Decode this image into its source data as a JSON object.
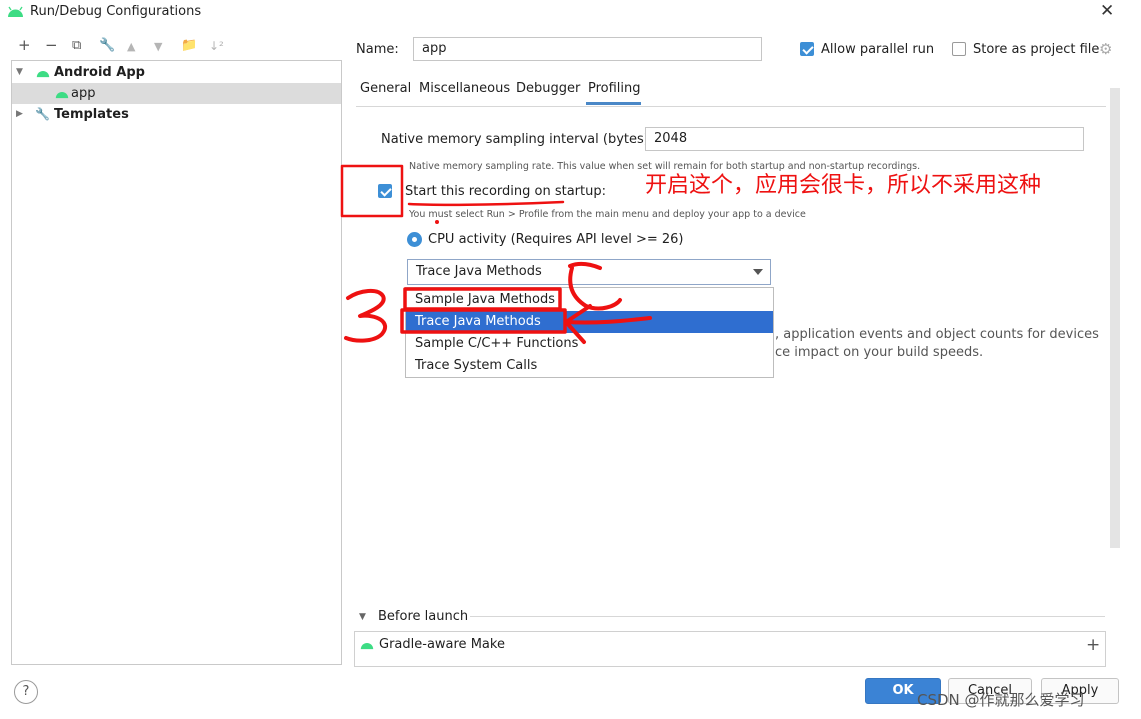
{
  "window": {
    "title": "Run/Debug Configurations",
    "close_glyph": "✕"
  },
  "toolbar": {
    "add": "+",
    "remove": "−",
    "copy": "⧉",
    "edit": "🔧",
    "up": "▲",
    "down": "▼",
    "folder": "📁",
    "sort": "↓²"
  },
  "tree": {
    "group_label": "Android App",
    "child_label": "app",
    "templates_label": "Templates"
  },
  "config": {
    "name_label": "Name:",
    "name_value": "app",
    "allow_parallel_label": "Allow parallel run",
    "allow_parallel_checked": true,
    "store_project_label": "Store as project file",
    "store_project_checked": false
  },
  "tabs": [
    "General",
    "Miscellaneous",
    "Debugger",
    "Profiling"
  ],
  "active_tab": "Profiling",
  "profiling": {
    "interval_label": "Native memory sampling interval (bytes):",
    "interval_value": "2048",
    "interval_hint": "Native memory sampling rate. This value when set will remain for both startup and non-startup recordings.",
    "startup_label": "Start this recording on startup:",
    "startup_checked": true,
    "startup_hint": "You must select Run > Profile from the main menu and deploy your app to a device",
    "cpu_label": "CPU activity (Requires API level >= 26)",
    "combo_value": "Trace Java Methods",
    "options": [
      "Sample Java Methods",
      "Trace Java Methods",
      "Sample C/C++ Functions",
      "Trace System Calls"
    ],
    "highlighted_option": "Trace Java Methods",
    "desc_line1": ", application events and object counts for devices",
    "desc_line2": "ce impact on your build speeds."
  },
  "before_launch": {
    "label": "Before launch",
    "item": "Gradle-aware Make",
    "add_glyph": "+"
  },
  "buttons": {
    "ok": "OK",
    "cancel": "Cancel",
    "apply": "Apply",
    "help": "?"
  },
  "annotations": {
    "note": "开启这个，应用会很卡，所以不采用这种",
    "watermark": "CSDN @作就那么爱学习",
    "color": "#ee1111"
  },
  "colors": {
    "accent": "#3d8fd6",
    "selection": "#2f6ed0",
    "ok_button": "#3b83d5"
  }
}
